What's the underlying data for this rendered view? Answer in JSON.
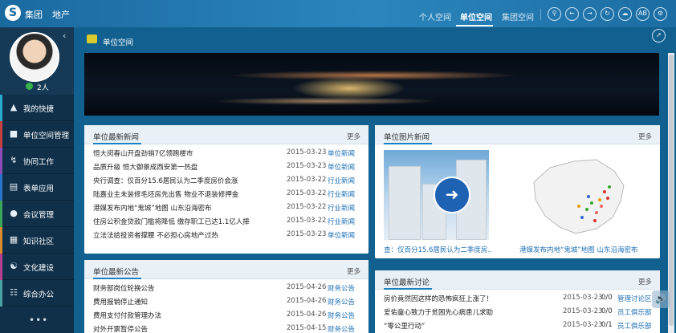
{
  "header": {
    "logo": "S",
    "brand": "集团",
    "brand_sub": "地产",
    "tabs": [
      {
        "label": "个人空间"
      },
      {
        "label": "单位空间"
      },
      {
        "label": "集团空间"
      }
    ],
    "icons": [
      "search-icon",
      "back-icon",
      "forward-icon",
      "refresh-icon",
      "cloud-icon",
      "font-size-icon",
      "settings-icon"
    ],
    "font_icon_label": "AB"
  },
  "sidebar": {
    "online_count": "2人",
    "menu": [
      {
        "label": "我的快捷",
        "icon": "shortcut-icon",
        "color": "#2aa9c9"
      },
      {
        "label": "单位空间管理",
        "icon": "building-icon",
        "color": "#c83f3f"
      },
      {
        "label": "协同工作",
        "icon": "collaborate-icon",
        "color": "#8c4bb8"
      },
      {
        "label": "表单应用",
        "icon": "form-icon",
        "color": "#2c74c9"
      },
      {
        "label": "会议管理",
        "icon": "meeting-icon",
        "color": "#3ba55c"
      },
      {
        "label": "知识社区",
        "icon": "knowledge-icon",
        "color": "#d88a2d"
      },
      {
        "label": "文化建设",
        "icon": "culture-icon",
        "color": "#b6408f"
      },
      {
        "label": "综合办公",
        "icon": "office-icon",
        "color": "#4aa3a3"
      }
    ],
    "more": "•••"
  },
  "breadcrumb": {
    "label": "单位空间"
  },
  "news": {
    "title": "单位最新新闻",
    "more": "更多",
    "rows": [
      {
        "title": "恒大闵春山开盘劲销7亿领跑楼市",
        "date": "2015-03-23",
        "category": "单位新闻"
      },
      {
        "title": "品质升级 恒大御景成西安第一热盘",
        "date": "2015-03-23",
        "category": "单位新闻"
      },
      {
        "title": "央行调查：仅百分15.6居民认为二季度房价会涨",
        "date": "2015-03-22",
        "category": "行业新闻"
      },
      {
        "title": "陆嘉业主未装修毛坯房先出售 物业不退装修押金",
        "date": "2015-03-22",
        "category": "行业新闻"
      },
      {
        "title": "港媒发布内地“鬼城”地图 山东沿海密布",
        "date": "2015-03-22",
        "category": "行业新闻"
      },
      {
        "title": "住房公积金贷款门槛将降低 缴存职工已达1.1亿人捧",
        "date": "2015-03-22",
        "category": "行业新闻"
      },
      {
        "title": "立法法给投资者撑腰 不必担心房地产过热",
        "date": "2015-03-23",
        "category": "单位新闻"
      }
    ]
  },
  "photo_news": {
    "title": "单位图片新闻",
    "more": "更多",
    "captions": [
      "查：仅百分15.6居民认为二季度房...",
      "港媒发布内地“鬼城”地图 山东沿海密布"
    ]
  },
  "notices": {
    "title": "单位最新公告",
    "more": "更多",
    "rows": [
      {
        "title": "财务部岗位轮换公告",
        "date": "2015-04-26",
        "category": "财务公告"
      },
      {
        "title": "费用报销停止通知",
        "date": "2015-04-26",
        "category": "财务公告"
      },
      {
        "title": "费用支付付款管理办法",
        "date": "2015-04-26",
        "category": "财务公告"
      },
      {
        "title": "对外开票暂停公告",
        "date": "2015-04-15",
        "category": "财务公告"
      }
    ]
  },
  "discussions": {
    "title": "单位最新讨论",
    "more": "更多",
    "rows": [
      {
        "title": "房价竟然因这样的恐怖疯狂上涨了！",
        "date": "2015-03-23",
        "count": "0/0",
        "category": "管理讨论区"
      },
      {
        "title": "爱佑童心致力于贫困先心病患儿求助",
        "date": "2015-03-23",
        "count": "0/0",
        "category": "员工俱乐部"
      },
      {
        "title": "“零公里行动”",
        "date": "2015-03-23",
        "count": "0/1",
        "category": "员工俱乐部"
      }
    ]
  }
}
